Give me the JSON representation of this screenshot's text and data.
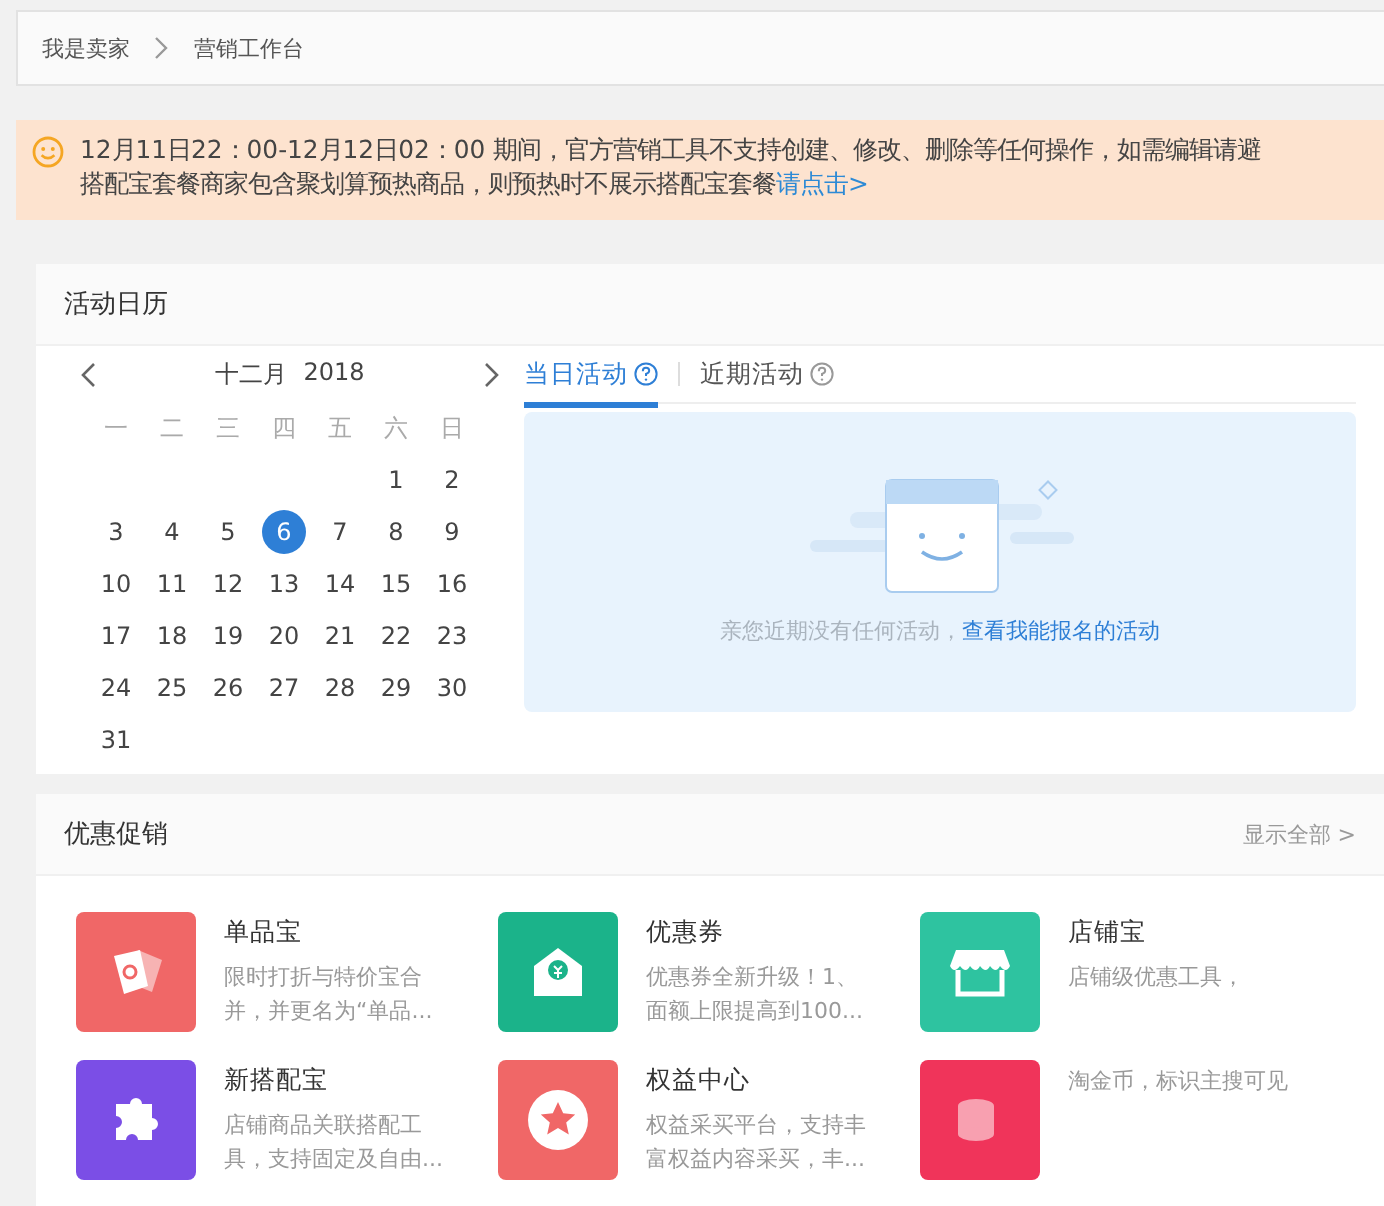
{
  "breadcrumb": [
    {
      "label": "我是卖家"
    },
    {
      "label": "营销工作台"
    }
  ],
  "notice": {
    "lines": [
      "12月11日22：00-12月12日02：00 期间，官方营销工具不支持创建、修改、删除等任何操作，如需编辑请避",
      "搭配宝套餐商家包含聚划算预热商品，则预热时不展示搭配宝套餐"
    ],
    "link": "请点击>"
  },
  "calendar_card": {
    "title": "活动日历",
    "month": "十二月",
    "year": "2018",
    "weekdays": [
      "一",
      "二",
      "三",
      "四",
      "五",
      "六",
      "日"
    ],
    "weeks": [
      [
        {
          "day": "1",
          "selected": false
        },
        {
          "day": "2",
          "selected": false
        }
      ],
      [
        {
          "day": "3",
          "selected": false
        },
        {
          "day": "4",
          "selected": false
        },
        {
          "day": "5",
          "selected": false
        },
        {
          "day": "6",
          "selected": true
        },
        {
          "day": "7",
          "selected": false
        },
        {
          "day": "8",
          "selected": false
        },
        {
          "day": "9",
          "selected": false
        }
      ],
      [
        {
          "day": "10",
          "selected": false
        },
        {
          "day": "11",
          "selected": false
        },
        {
          "day": "12",
          "selected": false
        },
        {
          "day": "13",
          "selected": false
        },
        {
          "day": "14",
          "selected": false
        },
        {
          "day": "15",
          "selected": false
        },
        {
          "day": "16",
          "selected": false
        }
      ],
      [
        {
          "day": "17",
          "selected": false
        },
        {
          "day": "18",
          "selected": false
        },
        {
          "day": "19",
          "selected": false
        },
        {
          "day": "20",
          "selected": false
        },
        {
          "day": "21",
          "selected": false
        },
        {
          "day": "22",
          "selected": false
        },
        {
          "day": "23",
          "selected": false
        }
      ],
      [
        {
          "day": "24",
          "selected": false
        },
        {
          "day": "25",
          "selected": false
        },
        {
          "day": "26",
          "selected": false
        },
        {
          "day": "27",
          "selected": false
        },
        {
          "day": "28",
          "selected": false
        },
        {
          "day": "29",
          "selected": false
        },
        {
          "day": "30",
          "selected": false
        }
      ],
      [
        {
          "day": "31",
          "selected": false
        }
      ]
    ],
    "tabs": [
      {
        "label": "当日活动",
        "selected": true
      },
      {
        "label": "近期活动",
        "selected": false
      }
    ],
    "empty_text": "亲您近期没有任何活动，",
    "empty_link": "查看我能报名的活动"
  },
  "promo_card": {
    "title": "优惠促销",
    "show_all": "显示全部 >",
    "tools": [
      {
        "kind": "tag",
        "color": "#f06767",
        "title": "单品宝",
        "desc": [
          "限时打折与特价宝合",
          "并，并更名为“单品..."
        ]
      },
      {
        "kind": "envelope",
        "color": "#1bb38a",
        "title": "优惠券",
        "desc": [
          "优惠券全新升级！1、",
          "面额上限提高到100..."
        ]
      },
      {
        "kind": "shop",
        "color": "#2ec3a0",
        "title": "店铺宝",
        "desc": [
          "店铺级优惠工具，"
        ]
      },
      {
        "kind": "puzzle",
        "color": "#7b4ee6",
        "title": "新搭配宝",
        "desc": [
          "店铺商品关联搭配工",
          "具，支持固定及自由..."
        ]
      },
      {
        "kind": "star",
        "color": "#f06767",
        "title": "权益中心",
        "desc": [
          "权益采买平台，支持丰",
          "富权益内容采买，丰..."
        ]
      },
      {
        "kind": "coins",
        "color": "#f0345a",
        "desc": [
          "淘金币，标识主搜可见"
        ]
      }
    ]
  }
}
